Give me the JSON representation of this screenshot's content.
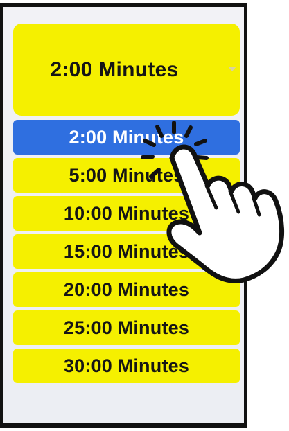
{
  "dropdown": {
    "selected_label": "2:00 Minutes",
    "icon": "chevron-down-icon"
  },
  "options": [
    {
      "label": "2:00 Minutes",
      "selected": true
    },
    {
      "label": "5:00 Minutes",
      "selected": false
    },
    {
      "label": "10:00 Minutes",
      "selected": false
    },
    {
      "label": "15:00 Minutes",
      "selected": false
    },
    {
      "label": "20:00 Minutes",
      "selected": false
    },
    {
      "label": "25:00 Minutes",
      "selected": false
    },
    {
      "label": "30:00 Minutes",
      "selected": false
    }
  ],
  "overlay": {
    "icon": "pointing-hand-tap-icon"
  },
  "colors": {
    "option_background": "#f5f000",
    "selected_background": "#2f6fe0",
    "selected_text": "#ffffff",
    "text": "#151515"
  }
}
